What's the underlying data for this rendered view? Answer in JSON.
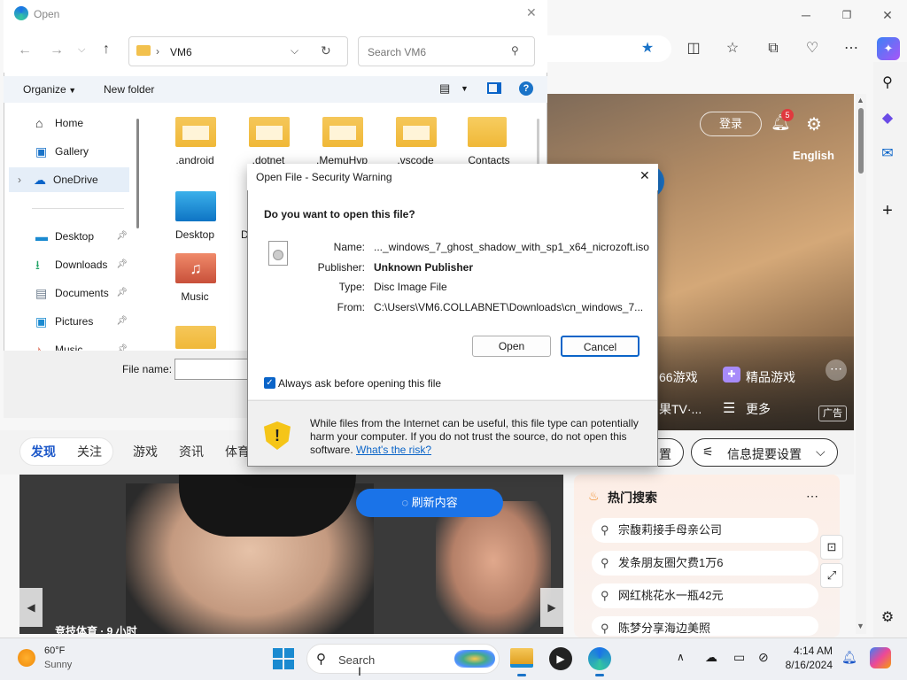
{
  "browser": {
    "hero": {
      "login_label": "登录",
      "notif_count": "5",
      "language": "English",
      "link_games_partial": "66游戏",
      "link_premium_games": "精品游戏",
      "link_tv_partial": "果TV·...",
      "link_more": "更多",
      "ad_label": "广告"
    },
    "categories": {
      "discover": "发现",
      "follow": "关注",
      "games": "游戏",
      "info": "资讯",
      "sports_partial": "体育",
      "partial_settings": "置",
      "summary_settings": "信息提要设置"
    },
    "news": {
      "refresh_label": "刷新内容",
      "caption": "竞技体育 · 9 小时"
    },
    "hot": {
      "title": "热门搜索",
      "items": [
        "宗馥莉接手母亲公司",
        "发条朋友圈欠费1万6",
        "网红桃花水一瓶42元",
        "陈梦分享海边美照"
      ]
    }
  },
  "file_dialog": {
    "title": "Open",
    "path": "VM6",
    "search_placeholder": "Search VM6",
    "organize": "Organize",
    "new_folder": "New folder",
    "nav": [
      {
        "label": "Home"
      },
      {
        "label": "Gallery"
      },
      {
        "label": "OneDrive"
      },
      {
        "label": "Desktop"
      },
      {
        "label": "Downloads"
      },
      {
        "label": "Documents"
      },
      {
        "label": "Pictures"
      },
      {
        "label": "Music"
      }
    ],
    "files": [
      {
        "label": ".android"
      },
      {
        "label": ".dotnet"
      },
      {
        "label": ".MemuHyp"
      },
      {
        "label": ".vscode"
      },
      {
        "label": "Contacts"
      },
      {
        "label": "Desktop"
      },
      {
        "label": "D"
      },
      {
        "label": "Music"
      }
    ],
    "filename_label": "File name:"
  },
  "security_dialog": {
    "title": "Open File - Security Warning",
    "question": "Do you want to open this file?",
    "name_key": "Name:",
    "name_value": "..._windows_7_ghost_shadow_with_sp1_x64_nicrozoft.iso",
    "publisher_key": "Publisher:",
    "publisher_value": "Unknown Publisher",
    "type_key": "Type:",
    "type_value": "Disc Image File",
    "from_key": "From:",
    "from_value": "C:\\Users\\VM6.COLLABNET\\Downloads\\cn_windows_7...",
    "open_label": "Open",
    "cancel_label": "Cancel",
    "always_ask": "Always ask before opening this file",
    "warning_text": "While files from the Internet can be useful, this file type can potentially harm your computer. If you do not trust the source, do not open this software.",
    "risk_link": "What's the risk?"
  },
  "taskbar": {
    "temp": "60°F",
    "weather": "Sunny",
    "search_placeholder": "Search",
    "time": "4:14 AM",
    "date": "8/16/2024"
  },
  "colors": {
    "accent": "#0a64c8",
    "edge_blue": "#1a73e8",
    "notif_red": "#e0393e"
  }
}
